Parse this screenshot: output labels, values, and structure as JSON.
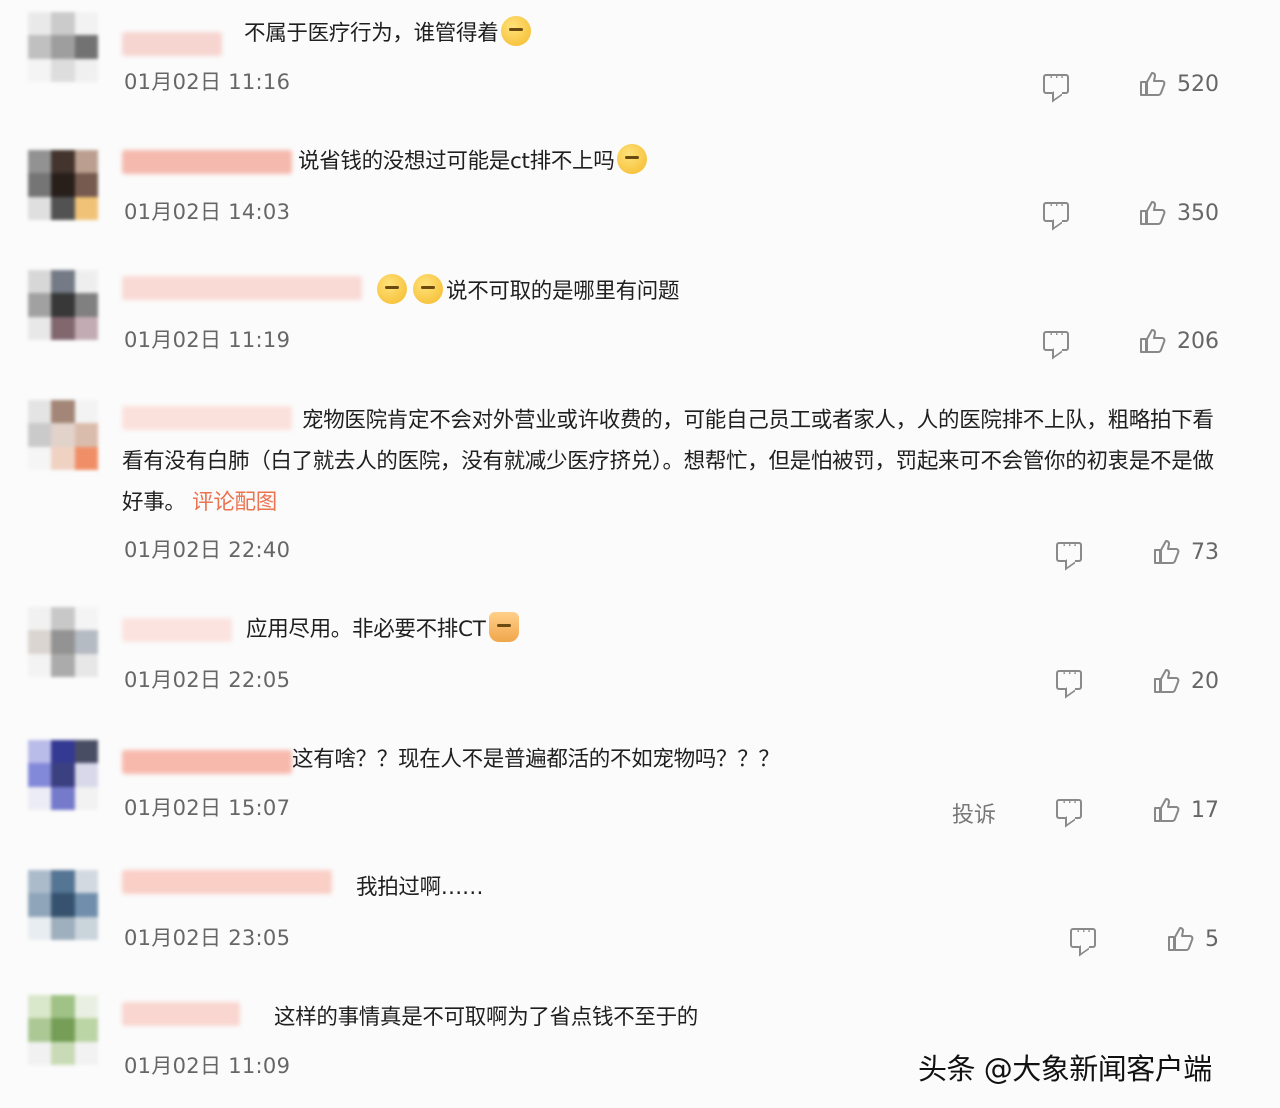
{
  "comments": [
    {
      "text": "不属于医疗行为，谁管得着",
      "time": "01月02日 11:16",
      "likes": "520"
    },
    {
      "text": "说省钱的没想过可能是ct排不上吗",
      "time": "01月02日 14:03",
      "likes": "350"
    },
    {
      "text": "说不可取的是哪里有问题",
      "time": "01月02日 11:19",
      "likes": "206"
    },
    {
      "text": "宠物医院肯定不会对外营业或许收费的，可能自己员工或者家人，人的医院排不上队，粗略拍下看看有没有白肺（白了就去人的医院，没有就减少医疗挤兑）。想帮忙，但是怕被罚，罚起来可不会管你的初衷是不是做好事。",
      "picture_link": "评论配图",
      "time": "01月02日 22:40",
      "likes": "73"
    },
    {
      "text": "应用尽用。非必要不排CT",
      "time": "01月02日 22:05",
      "likes": "20"
    },
    {
      "text": "这有啥？？现在人不是普遍都活的不如宠物吗？？？",
      "time": "01月02日 15:07",
      "report": "投诉",
      "likes": "17"
    },
    {
      "text": "我拍过啊……",
      "time": "01月02日 23:05",
      "likes": "5"
    },
    {
      "text": "这样的事情真是不可取啊为了省点钱不至于的",
      "time": "01月02日 11:09"
    }
  ],
  "watermark": "头条 @大象新闻客户端",
  "icons": {
    "reply": "comment-icon",
    "like": "thumbs-up-icon"
  }
}
